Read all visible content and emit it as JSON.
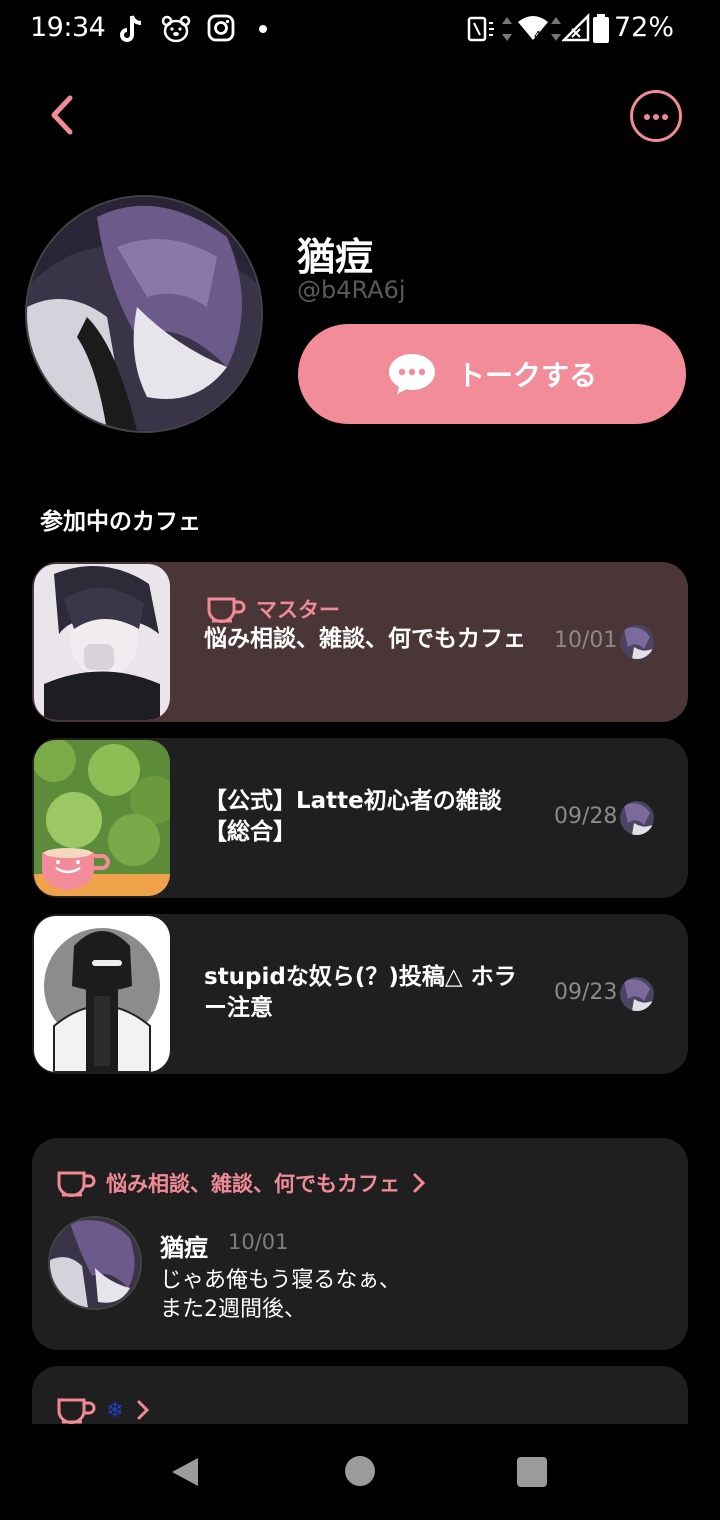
{
  "status_bar": {
    "time": "19:34",
    "battery": "72%",
    "icons": [
      "tiktok-icon",
      "bear-app-icon",
      "instagram-icon",
      "notification-dot-icon",
      "nfc-icon",
      "wifi-icon",
      "signal-icon",
      "battery-icon"
    ]
  },
  "header": {
    "back_icon": "chevron-left-icon",
    "more_icon": "more-horizontal-icon"
  },
  "profile": {
    "name": "猶痘",
    "handle": "@b4RA6j",
    "talk_button_label": "トークする",
    "talk_icon": "chat-bubble-icon"
  },
  "cafes_section": {
    "title": "参加中のカフェ",
    "items": [
      {
        "role": "マスター",
        "title": "悩み相談、雑談、何でもカフェ",
        "date": "10/01"
      },
      {
        "role": "",
        "title": "【公式】Latte初心者の雑談【総合】",
        "date": "09/28"
      },
      {
        "role": "",
        "title": "stupidな奴ら(？)投稿△ ホラー注意",
        "date": "09/23"
      }
    ]
  },
  "posts": [
    {
      "cafe_name": "悩み相談、雑談、何でもカフェ",
      "author": "猶痘",
      "date": "10/01",
      "body": "じゃあ俺もう寝るなぁ、\nまた2週間後、"
    },
    {
      "cafe_name": "❄"
    }
  ],
  "colors": {
    "accent": "#f08a96",
    "button": "#f28c98",
    "card": "#1f1f1f",
    "card_highlight": "#4a3537",
    "background": "#000000"
  },
  "nav_bar": {
    "icons": [
      "nav-back-icon",
      "nav-home-icon",
      "nav-recents-icon"
    ]
  }
}
